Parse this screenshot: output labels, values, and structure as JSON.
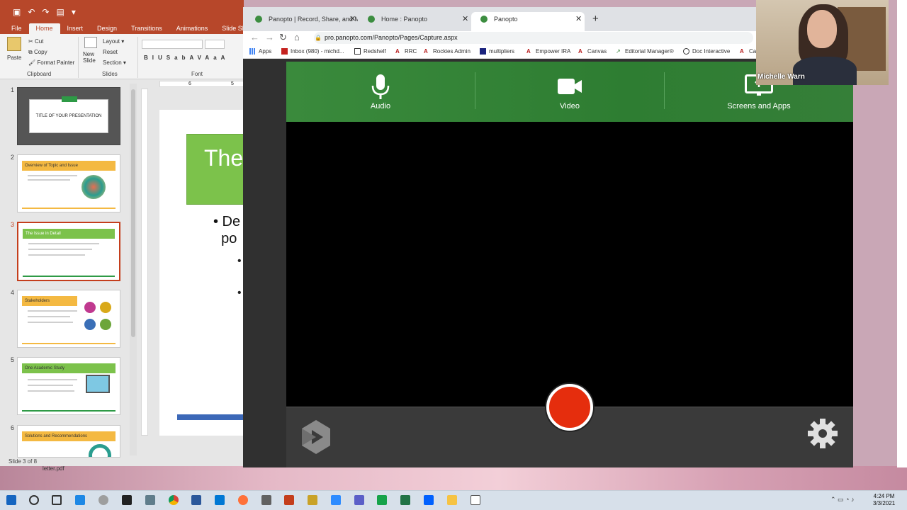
{
  "powerpoint": {
    "tabs": [
      "File",
      "Home",
      "Insert",
      "Design",
      "Transitions",
      "Animations",
      "Slide Show"
    ],
    "active_tab": "Home",
    "clipboard": {
      "paste": "Paste",
      "cut": "Cut",
      "copy": "Copy",
      "format_painter": "Format Painter",
      "group": "Clipboard"
    },
    "slides_group": {
      "new_slide": "New Slide",
      "layout": "Layout",
      "reset": "Reset",
      "section": "Section",
      "group": "Slides"
    },
    "font_group": "Font",
    "font_buttons": [
      "B",
      "I",
      "U",
      "S",
      "ab",
      "AV",
      "Aa",
      "A"
    ],
    "thumbnails": [
      {
        "num": "1",
        "title": "TITLE OF YOUR PRESENTATION"
      },
      {
        "num": "2",
        "title": "Overview of Topic and Issue"
      },
      {
        "num": "3",
        "title": "The Issue in Detail"
      },
      {
        "num": "4",
        "title": "Stakeholders"
      },
      {
        "num": "5",
        "title": "One Academic Study"
      },
      {
        "num": "6",
        "title": "Solutions and Recommendations"
      }
    ],
    "canvas_title": "The",
    "canvas_bullet": "• De\n  po",
    "status": "Slide 3 of 8",
    "ruler_marks": [
      "6",
      "5"
    ]
  },
  "browser": {
    "tabs": [
      {
        "label": "Panopto | Record, Share, and Ma"
      },
      {
        "label": "Home : Panopto"
      },
      {
        "label": "Panopto"
      }
    ],
    "url": "pro.panopto.com/Panopto/Pages/Capture.aspx",
    "bookmarks": [
      "Apps",
      "Inbox (980) - michd...",
      "Redshelf",
      "RRC",
      "Rockies Admin",
      "multipliers",
      "Empower IRA",
      "Canvas",
      "Editorial Manager®",
      "Doc Interactive",
      "Ca"
    ]
  },
  "capture": {
    "sources": [
      {
        "label": "Audio",
        "icon": "microphone-icon"
      },
      {
        "label": "Video",
        "icon": "video-camera-icon"
      },
      {
        "label": "Screens and Apps",
        "icon": "monitor-icon"
      }
    ],
    "accent": "#2e7d32",
    "record_color": "#e52d0d"
  },
  "webcam": {
    "name": "Michelle Warn"
  },
  "desktop": {
    "file_label": "letter.pdf"
  },
  "taskbar": {
    "time": "4:24 PM",
    "date": "3/3/2021"
  }
}
